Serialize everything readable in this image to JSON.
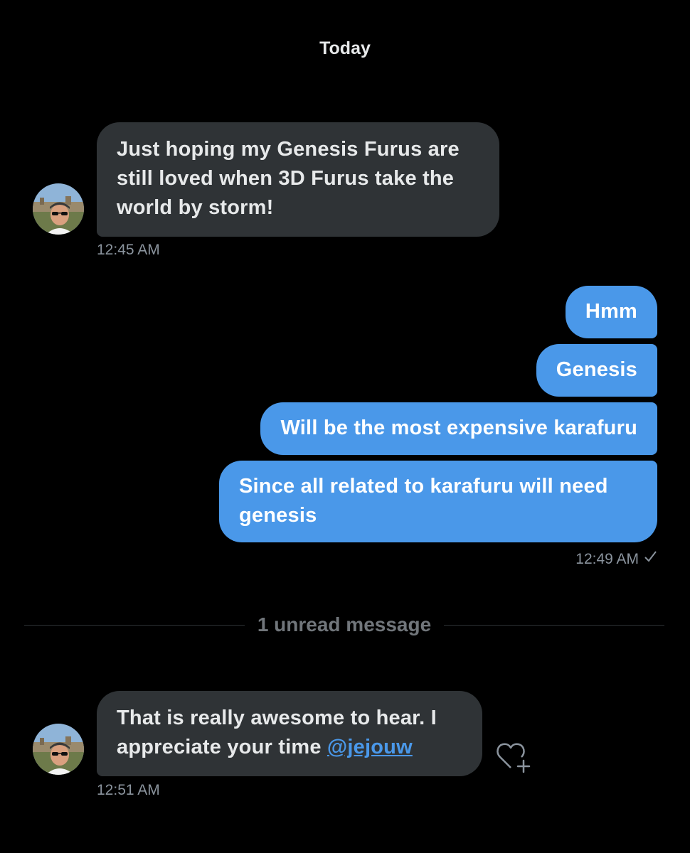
{
  "day_header": "Today",
  "messages": {
    "m1": {
      "line1": "Just hoping my Genesis Furus are",
      "line2": "still loved when 3D Furus take the",
      "line3": "world by storm!",
      "time": "12:45 AM"
    },
    "out1": "Hmm",
    "out2": "Genesis",
    "out3": "Will be the most expensive karafuru",
    "out4": "Since all related to karafuru will need genesis",
    "out_time": "12:49 AM",
    "m2": {
      "text_line1": "That is really awesome to hear. I",
      "text_line2_prefix": "appreciate your time ",
      "mention": "@jejouw",
      "time": "12:51 AM"
    }
  },
  "unread_divider": "1 unread message",
  "icons": {
    "read_receipt": "checkmark-icon",
    "react": "heart-plus-icon",
    "avatar": "user-avatar"
  },
  "colors": {
    "background": "#000000",
    "incoming_bubble": "#2f3336",
    "outgoing_bubble": "#4a98e9",
    "timestamp": "#8b949e",
    "divider_text": "#71767b",
    "mention": "#4a98e9"
  }
}
